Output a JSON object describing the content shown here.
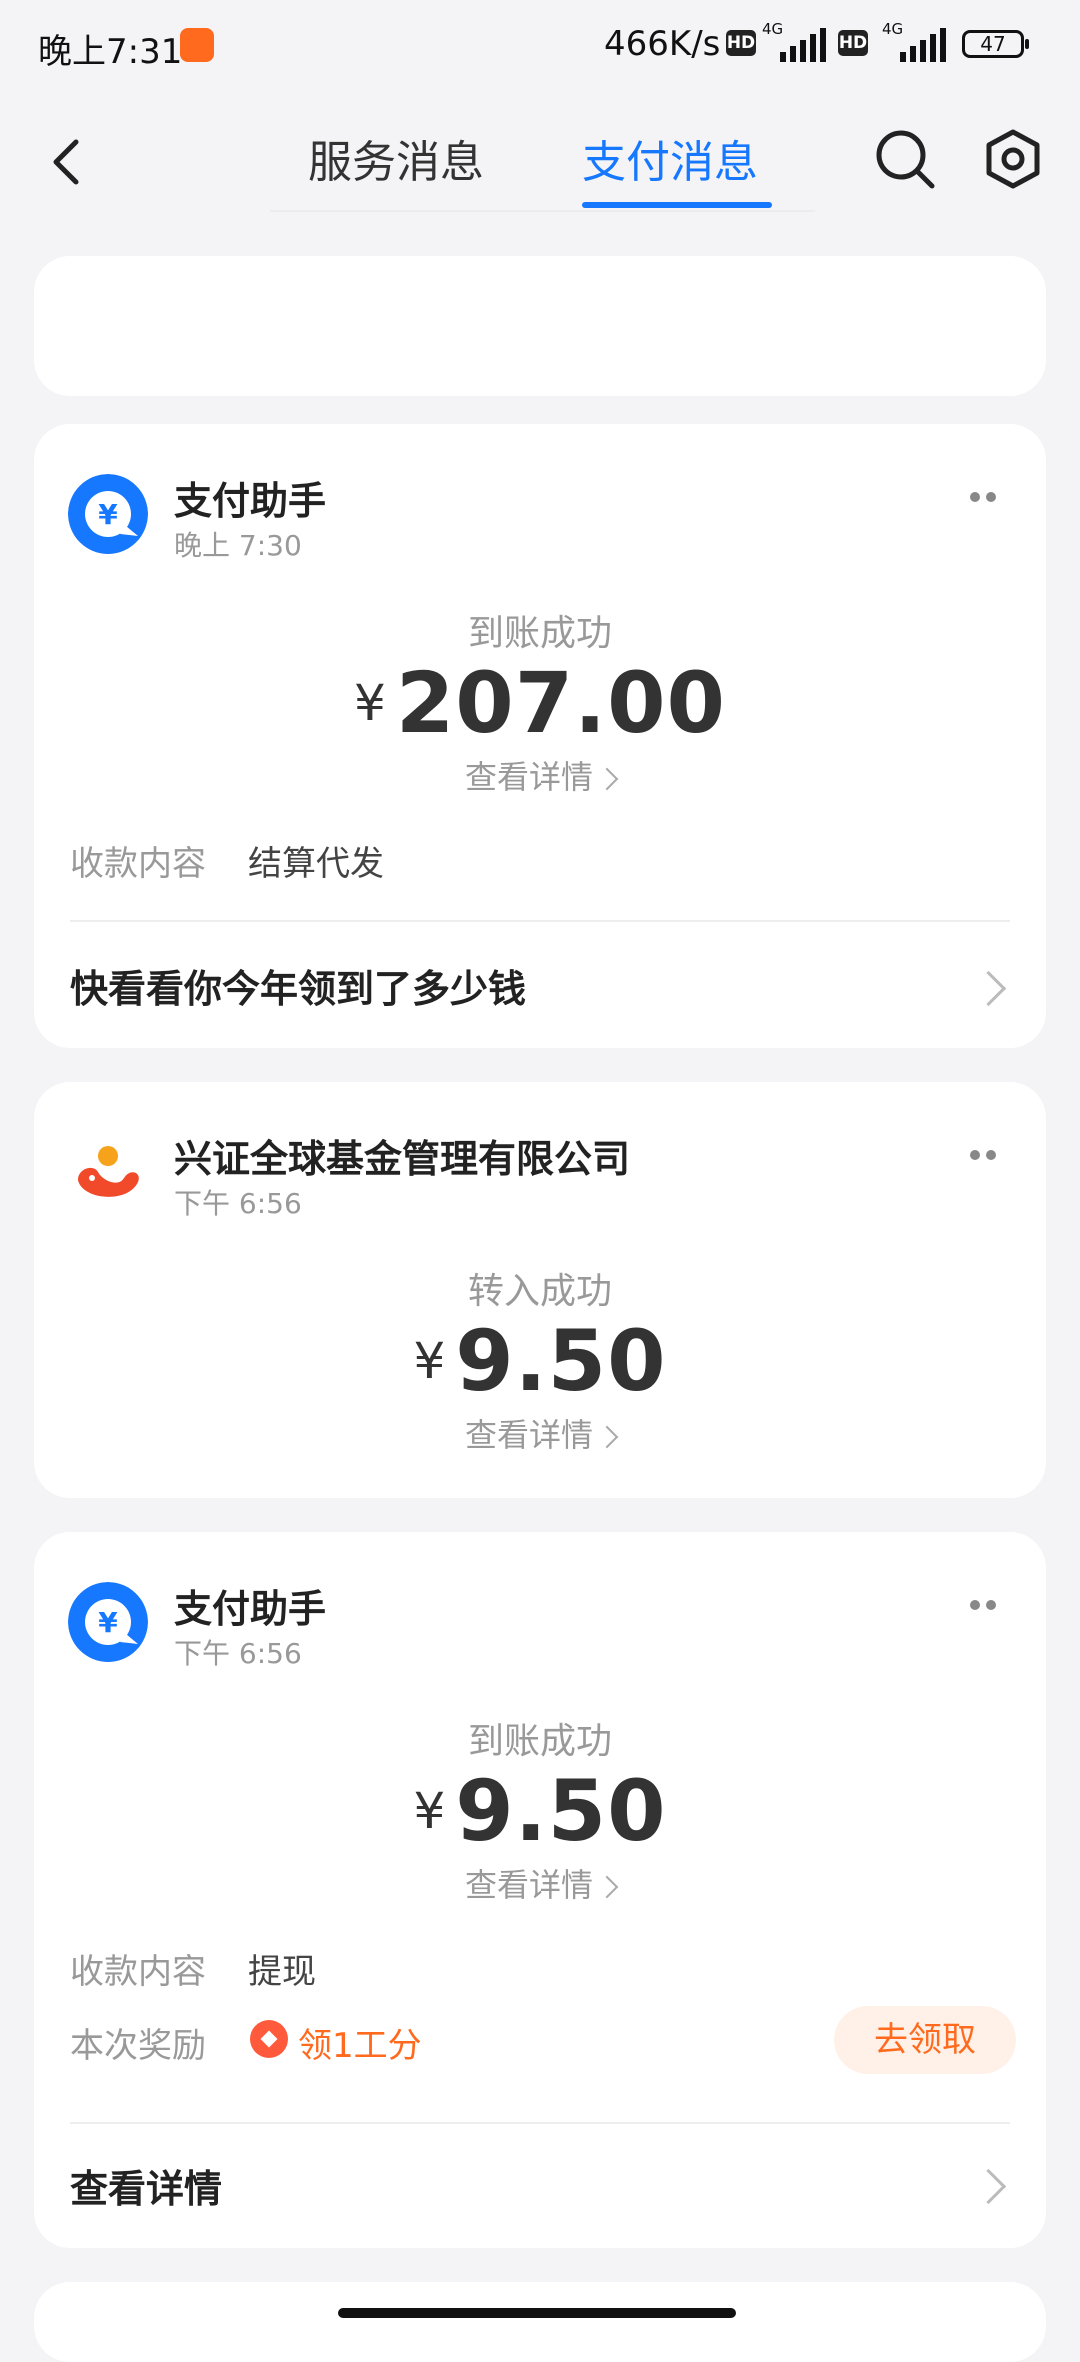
{
  "status_bar": {
    "time": "晚上7:31",
    "net_speed": "466K/s",
    "hd": "HD",
    "network": "4G",
    "battery": "47"
  },
  "header": {
    "tabs": [
      {
        "label": "服务消息",
        "active": false
      },
      {
        "label": "支付消息",
        "active": true
      }
    ],
    "accent_color": "#1677ff"
  },
  "cards": [
    {
      "sender": "支付助手",
      "time": "晚上 7:30",
      "status": "到账成功",
      "currency": "¥",
      "amount": "207.00",
      "detail_link": "查看详情",
      "rows": [
        {
          "label": "收款内容",
          "value": "结算代发"
        }
      ],
      "footer_link": "快看看你今年领到了多少钱"
    },
    {
      "sender": "兴证全球基金管理有限公司",
      "time": "下午 6:56",
      "status": "转入成功",
      "currency": "¥",
      "amount": "9.50",
      "detail_link": "查看详情"
    },
    {
      "sender": "支付助手",
      "time": "下午 6:56",
      "status": "到账成功",
      "currency": "¥",
      "amount": "9.50",
      "detail_link": "查看详情",
      "rows": [
        {
          "label": "收款内容",
          "value": "提现"
        },
        {
          "label": "本次奖励",
          "value": "领1工分"
        }
      ],
      "claim_button": "去领取",
      "footer_link": "查看详情"
    }
  ]
}
